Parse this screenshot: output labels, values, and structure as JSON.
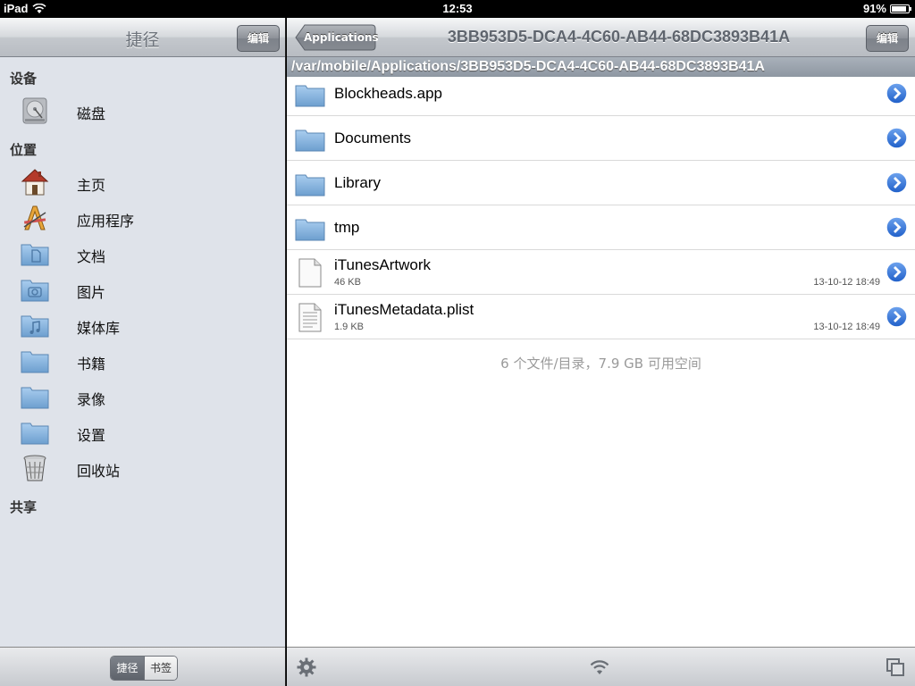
{
  "status": {
    "device": "iPad",
    "time": "12:53",
    "battery": "91%",
    "battery_level": 0.91
  },
  "sidebar": {
    "title": "捷径",
    "edit_label": "编辑",
    "sections": {
      "devices": "设备",
      "places": "位置",
      "shared": "共享"
    },
    "items": [
      {
        "label": "磁盘",
        "icon": "disk-icon"
      },
      {
        "label": "主页",
        "icon": "home-icon"
      },
      {
        "label": "应用程序",
        "icon": "applications-icon"
      },
      {
        "label": "文档",
        "icon": "documents-folder-icon"
      },
      {
        "label": "图片",
        "icon": "pictures-folder-icon"
      },
      {
        "label": "媒体库",
        "icon": "music-folder-icon"
      },
      {
        "label": "书籍",
        "icon": "folder-icon"
      },
      {
        "label": "录像",
        "icon": "folder-icon"
      },
      {
        "label": "设置",
        "icon": "folder-icon"
      },
      {
        "label": "回收站",
        "icon": "trash-icon"
      }
    ],
    "segments": {
      "shortcuts": "捷径",
      "bookmarks": "书签",
      "selected": "捷径"
    }
  },
  "browser": {
    "back_label": "Applications",
    "title": "3BB953D5-DCA4-4C60-AB44-68DC3893B41A",
    "edit_label": "编辑",
    "path": "/var/mobile/Applications/3BB953D5-DCA4-4C60-AB44-68DC3893B41A",
    "entries": [
      {
        "name": "Blockheads.app",
        "kind": "folder"
      },
      {
        "name": "Documents",
        "kind": "folder"
      },
      {
        "name": "Library",
        "kind": "folder"
      },
      {
        "name": "tmp",
        "kind": "folder"
      },
      {
        "name": "iTunesArtwork",
        "kind": "file",
        "size": "46 KB",
        "date": "13-10-12 18:49"
      },
      {
        "name": "iTunesMetadata.plist",
        "kind": "plist",
        "size": "1.9 KB",
        "date": "13-10-12 18:49"
      }
    ],
    "summary": "6 个文件/目录，7.9 GB 可用空间"
  },
  "colors": {
    "accent_blue": "#2f6fd8",
    "folder_blue": "#7fb0dd"
  }
}
